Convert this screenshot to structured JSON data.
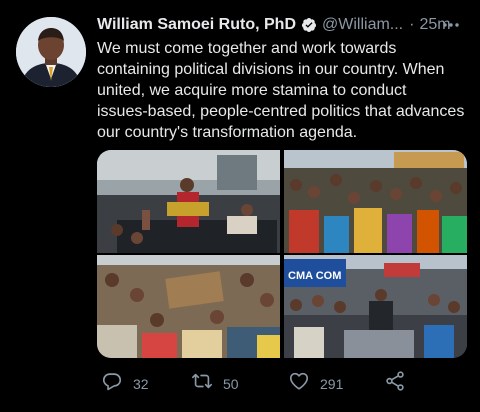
{
  "tweet": {
    "author_name": "William Samoei Ruto, PhD",
    "handle": "@William...",
    "separator": "·",
    "time": "25m",
    "text": "We must come together and work towards\ncontaining political divisions in our country. When\nunited, we acquire more stamina to conduct\nissues-based, people-centred politics that advances\nour country's transformation  agenda."
  },
  "media": {
    "banner_text": "CMA COM"
  },
  "actions": {
    "replies": "32",
    "retweets": "50",
    "likes": "291"
  },
  "colors": {
    "background": "#000000",
    "text": "#e7e9ea",
    "muted": "#8b98a5",
    "verified": "#1d9bf0"
  },
  "icons": [
    "verified-badge-icon",
    "more-icon",
    "reply-icon",
    "retweet-icon",
    "like-icon",
    "share-icon"
  ]
}
